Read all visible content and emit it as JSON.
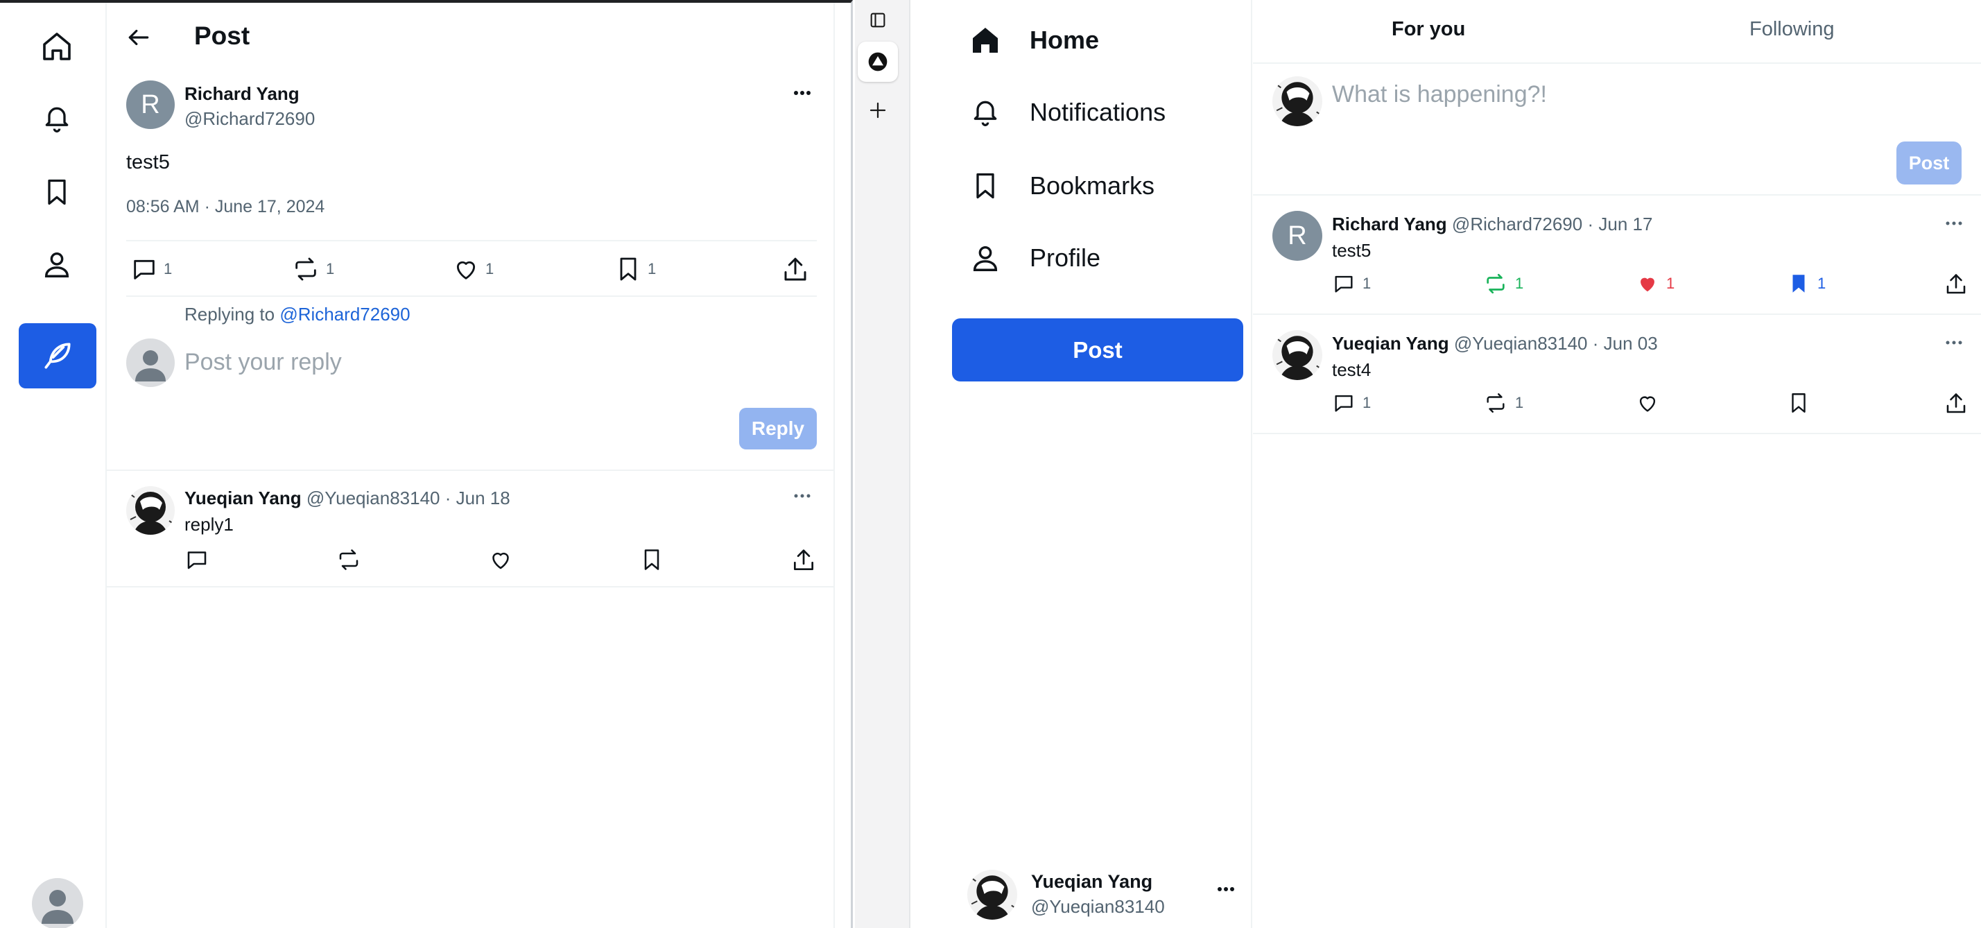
{
  "left_window": {
    "header": {
      "title": "Post"
    },
    "rail": {
      "items": [
        "home-icon",
        "bell-icon",
        "bookmark-icon",
        "person-icon"
      ],
      "compose_icon": "feather-icon"
    },
    "post": {
      "avatar_letter": "R",
      "author_name": "Richard Yang",
      "author_handle": "@Richard72690",
      "text": "test5",
      "timestamp": "08:56 AM · June 17, 2024",
      "actions": {
        "replies": "1",
        "reposts": "1",
        "likes": "1",
        "bookmarks": "1"
      }
    },
    "reply_box": {
      "replying_prefix": "Replying to",
      "replying_handle": "@Richard72690",
      "placeholder": "Post your reply",
      "button_label": "Reply"
    },
    "replies": [
      {
        "author_name": "Yueqian Yang",
        "author_handle": "@Yueqian83140",
        "date": "Jun 18",
        "text": "reply1"
      }
    ]
  },
  "right_window": {
    "nav": {
      "items": [
        {
          "label": "Home",
          "icon": "home-icon"
        },
        {
          "label": "Notifications",
          "icon": "bell-icon"
        },
        {
          "label": "Bookmarks",
          "icon": "bookmark-icon"
        },
        {
          "label": "Profile",
          "icon": "person-icon"
        }
      ],
      "post_button": "Post",
      "user": {
        "name": "Yueqian Yang",
        "handle": "@Yueqian83140"
      }
    },
    "tabs": [
      "For you",
      "Following"
    ],
    "composer": {
      "placeholder": "What is happening?!",
      "button_label": "Post"
    },
    "feed": [
      {
        "avatar_letter": "R",
        "author_name": "Richard Yang",
        "author_handle": "@Richard72690",
        "date": "Jun 17",
        "text": "test5",
        "actions": {
          "replies": "1",
          "reposts": "1",
          "likes": "1",
          "bookmarks": "1"
        }
      },
      {
        "author_name": "Yueqian Yang",
        "author_handle": "@Yueqian83140",
        "date": "Jun 03",
        "text": "test4",
        "actions": {
          "replies": "1",
          "reposts": "1"
        }
      }
    ]
  },
  "colors": {
    "accent": "#1d5de4",
    "accent_disabled": "#93b4f0",
    "repost_active": "#19b35a",
    "like_active": "#e53945",
    "muted_text": "#536471"
  }
}
